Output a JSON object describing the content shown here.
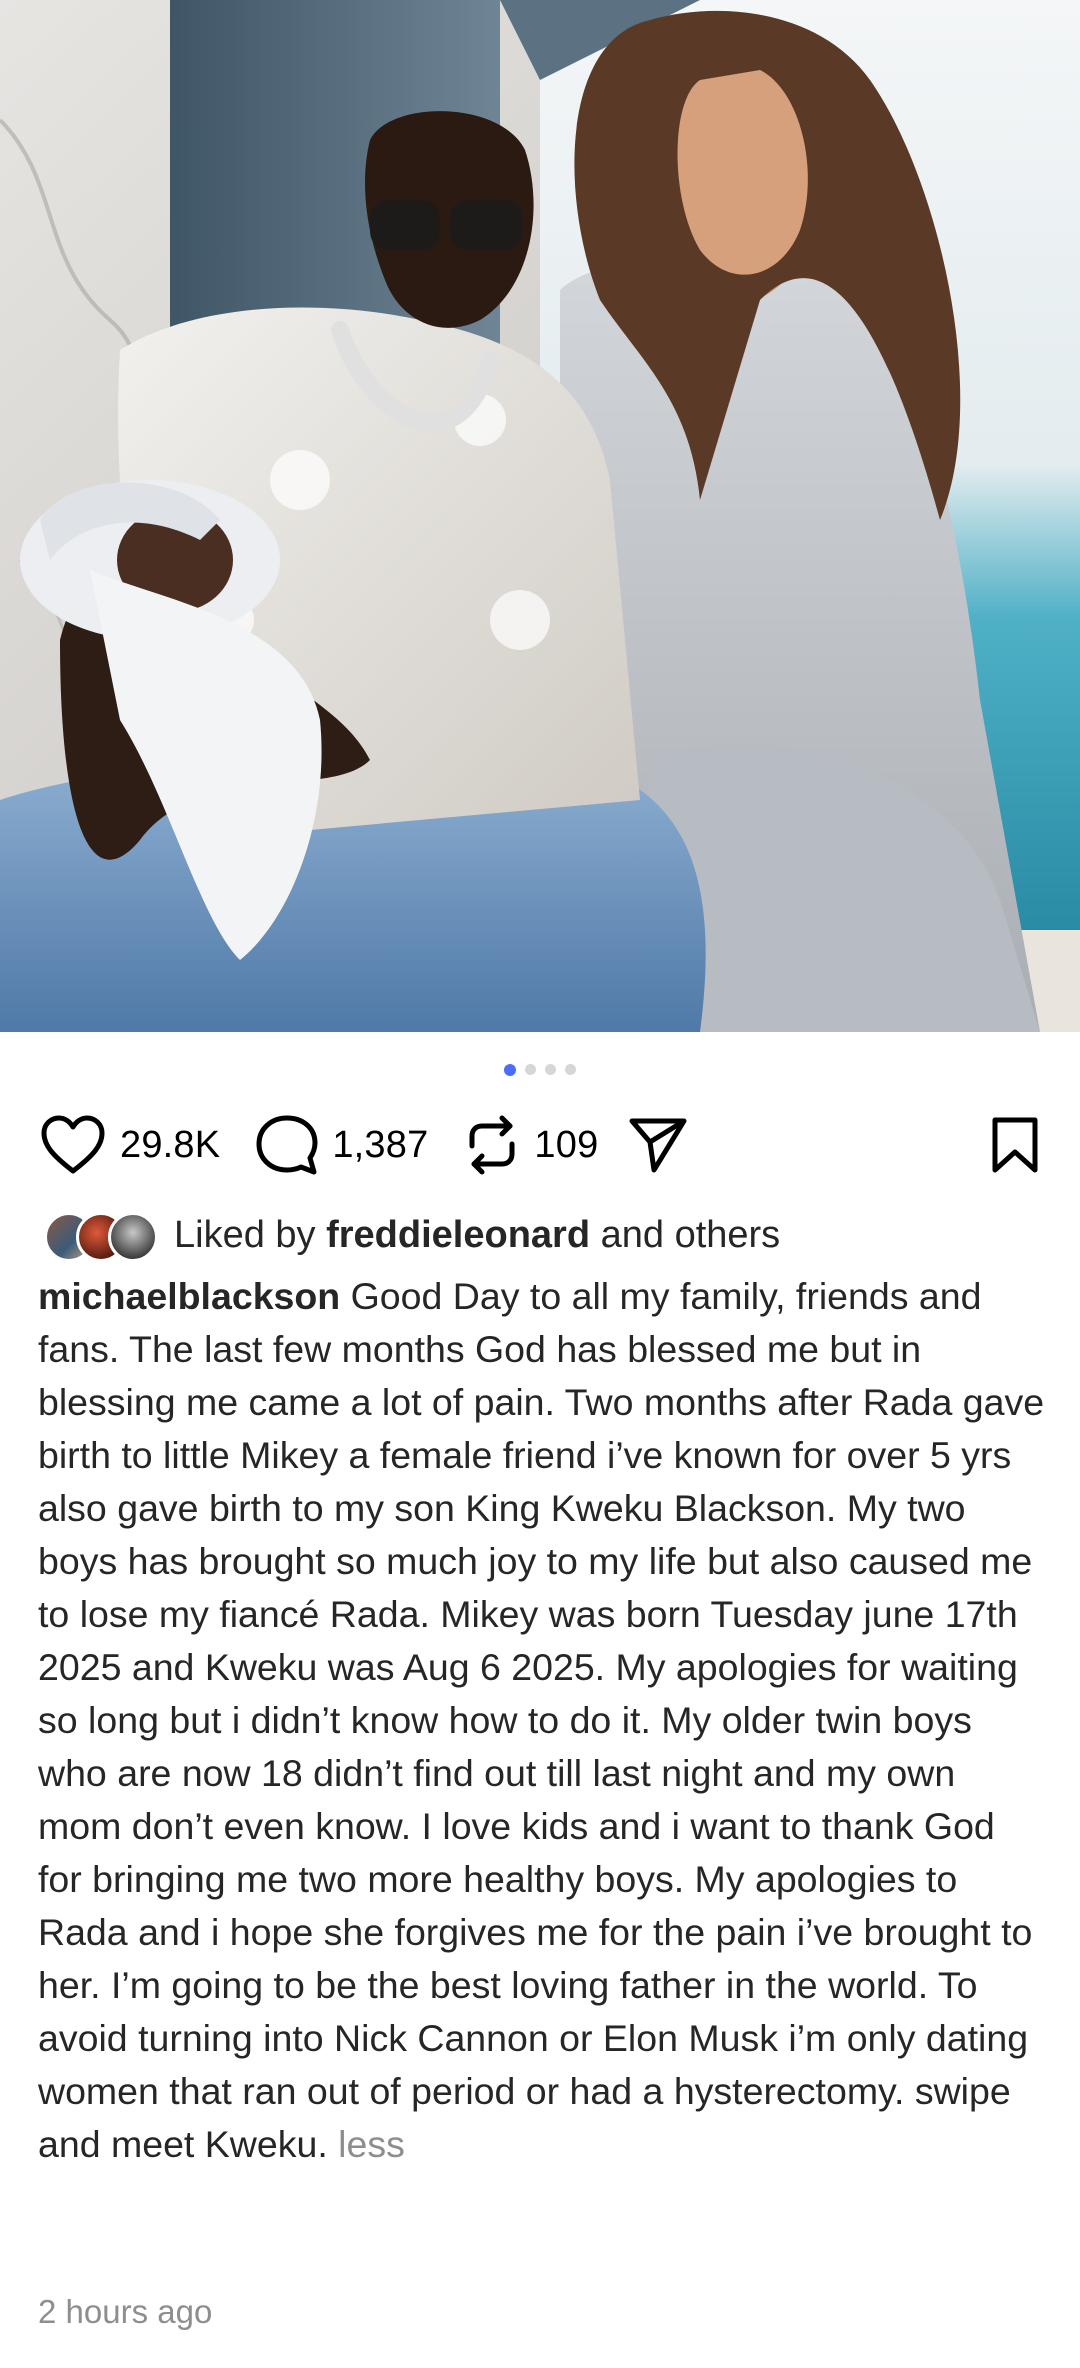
{
  "post": {
    "media": {
      "carousel_total": 4,
      "carousel_active": 1,
      "accent_color": "#4d6bfe"
    },
    "actions": {
      "likes": "29.8K",
      "comments": "1,387",
      "reposts": "109",
      "like_icon": "heart-icon",
      "comment_icon": "comment-icon",
      "repost_icon": "repost-icon",
      "share_icon": "send-icon",
      "save_icon": "bookmark-icon"
    },
    "liked_by": {
      "prefix": "Liked by ",
      "user": "freddieleonard",
      "suffix": " and others"
    },
    "caption": {
      "username": "michaelblackson",
      "text": "Good Day to all my family, friends and fans. The last few months God has blessed me but in blessing me came a lot of pain. Two months after Rada gave birth to little Mikey a female friend i’ve known for over 5 yrs also gave birth to my son King Kweku Blackson. My two boys has brought so much joy to my life but also caused me to lose my fiancé Rada. Mikey was born Tuesday june 17th 2025 and Kweku was Aug 6 2025. My apologies for waiting so long but i didn’t know how to do it. My older twin boys who are now 18 didn’t find out till last night and my own mom don’t even know. I love kids and i want to thank God for bringing me two more healthy boys. My apologies to Rada and i hope she forgives me for the pain i’ve brought to her. I’m going to be the best loving father in the world. To avoid turning into Nick Cannon or Elon Musk i’m only dating women that ran out of period or had a hysterectomy. swipe and meet Kweku.",
      "less_label": "less"
    },
    "timestamp": "2 hours ago"
  }
}
